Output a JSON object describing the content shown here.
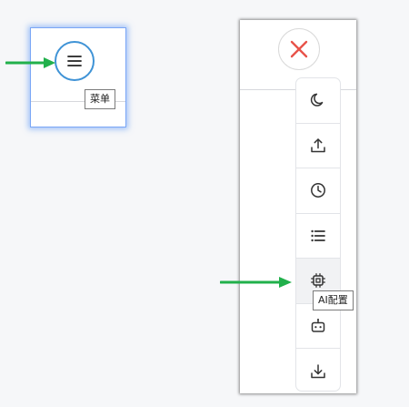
{
  "menu_panel": {
    "menu_tooltip": "菜单"
  },
  "sidebar": {
    "tools": [
      {
        "icon": "moon-icon"
      },
      {
        "icon": "upload-icon"
      },
      {
        "icon": "clock-icon"
      },
      {
        "icon": "list-icon"
      },
      {
        "icon": "chip-icon",
        "active": true
      },
      {
        "icon": "robot-icon"
      },
      {
        "icon": "download-icon"
      }
    ],
    "active_tooltip": "AI配置"
  },
  "colors": {
    "arrow": "#21b04b",
    "menu_ring": "#3f93d6",
    "close_x": "#e8534a",
    "icon": "#333333"
  }
}
